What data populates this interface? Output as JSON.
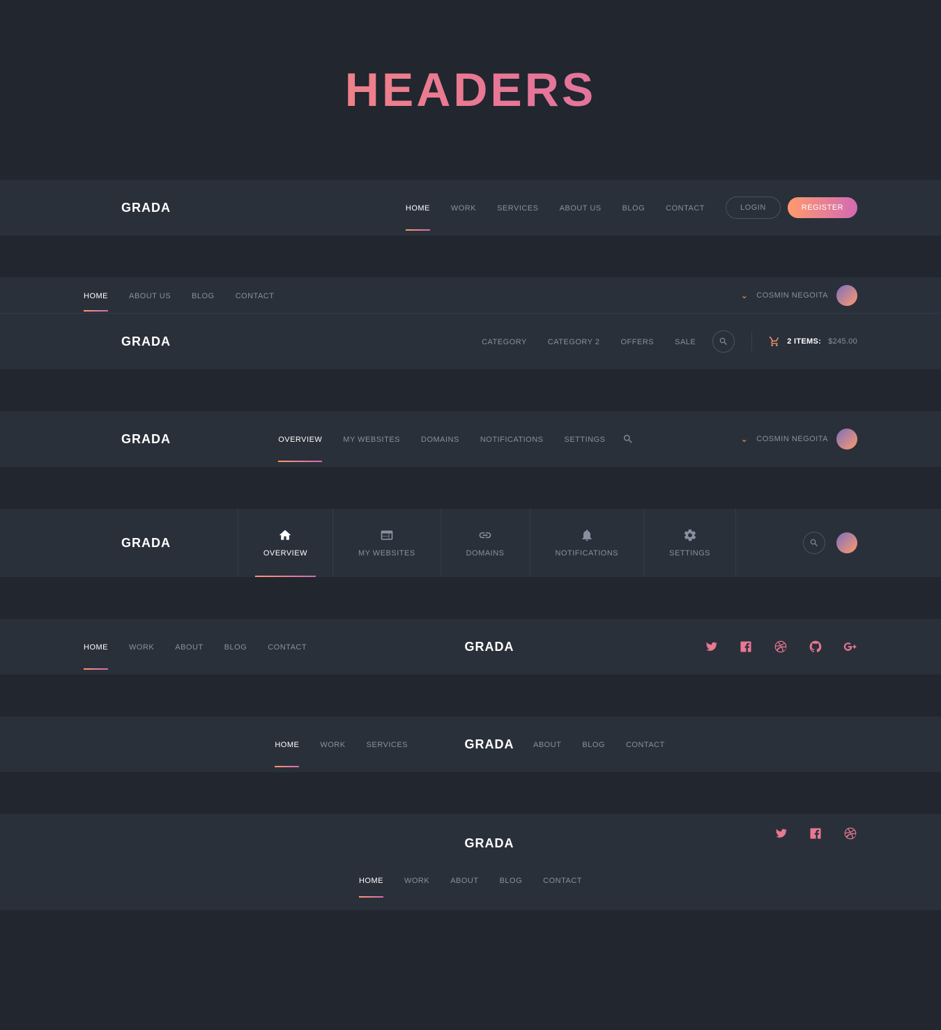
{
  "page_title": "HEADERS",
  "brand": "GRADA",
  "user_name": "COSMIN NEGOITA",
  "buttons": {
    "login": "LOGIN",
    "register": "REGISTER"
  },
  "cart": {
    "items_label": "2 ITEMS:",
    "amount": "$245.00"
  },
  "nav1": {
    "home": "HOME",
    "work": "WORK",
    "services": "SERVICES",
    "about": "ABOUT US",
    "blog": "BLOG",
    "contact": "CONTACT"
  },
  "nav2_top": {
    "home": "HOME",
    "about": "ABOUT US",
    "blog": "BLOG",
    "contact": "CONTACT"
  },
  "nav2_bottom": {
    "cat1": "CATEGORY",
    "cat2": "CATEGORY 2",
    "offers": "OFFERS",
    "sale": "SALE"
  },
  "nav3": {
    "overview": "OVERVIEW",
    "my_websites": "MY WEBSITES",
    "domains": "DOMAINS",
    "notifications": "NOTIFICATIONS",
    "settings": "SETTINGS"
  },
  "nav4": {
    "overview": "OVERVIEW",
    "my_websites": "MY WEBSITES",
    "domains": "DOMAINS",
    "notifications": "NOTIFICATIONS",
    "settings": "SETTINGS"
  },
  "nav5": {
    "home": "HOME",
    "work": "WORK",
    "about": "ABOUT",
    "blog": "BLOG",
    "contact": "CONTACT"
  },
  "nav6_left": {
    "home": "HOME",
    "work": "WORK",
    "services": "SERVICES"
  },
  "nav6_right": {
    "about": "ABOUT",
    "blog": "BLOG",
    "contact": "CONTACT"
  },
  "nav7": {
    "home": "HOME",
    "work": "WORK",
    "about": "ABOUT",
    "blog": "BLOG",
    "contact": "CONTACT"
  }
}
